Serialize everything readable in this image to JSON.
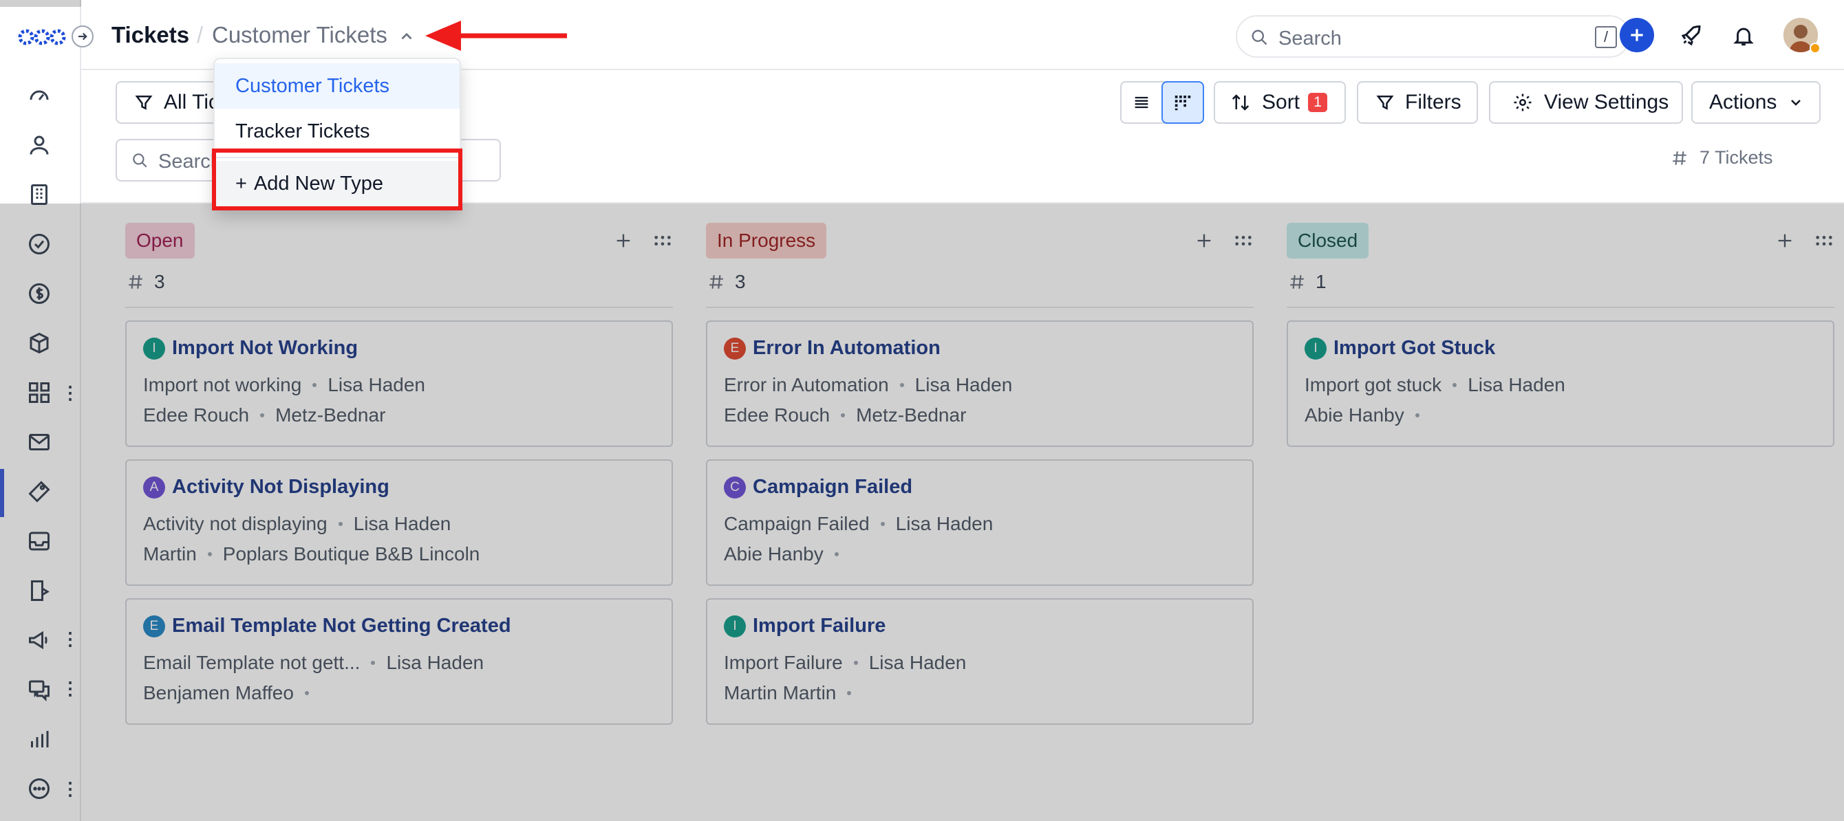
{
  "header": {
    "breadcrumb_main": "Tickets",
    "breadcrumb_sep": "/",
    "breadcrumb_sub": "Customer Tickets",
    "search_placeholder": "Search",
    "search_shortcut": "/"
  },
  "dropdown": {
    "items": [
      "Customer Tickets",
      "Tracker Tickets"
    ],
    "selected": "Customer Tickets",
    "add_label": "Add New Type",
    "add_prefix": "+"
  },
  "toolbar": {
    "all_tickets_label": "All Tickets",
    "sort_label": "Sort",
    "sort_count": "1",
    "filters_label": "Filters",
    "view_settings_label": "View Settings",
    "actions_label": "Actions",
    "search_placeholder": "Search",
    "ticket_count": "7 Tickets"
  },
  "sidebar": {
    "icons": [
      "dashboard-icon",
      "contacts-icon",
      "companies-icon",
      "tasks-icon",
      "deals-icon",
      "products-icon",
      "apps-icon",
      "mail-icon",
      "tickets-icon",
      "inbox-icon",
      "knowledge-icon",
      "campaigns-icon",
      "chat-icon",
      "reports-icon",
      "more-icon"
    ],
    "active": "tickets-icon"
  },
  "columns": [
    {
      "name": "Open",
      "count": "3",
      "pill_bg": "#f5d0dc",
      "pill_fg": "#9d174d",
      "cards": [
        {
          "badge": "I",
          "badge_color": "#0f9d8a",
          "title": "Import Not Working",
          "line1_a": "Import not working",
          "line1_b": "Lisa Haden",
          "line2_a": "Edee Rouch",
          "line2_b": "Metz-Bednar"
        },
        {
          "badge": "A",
          "badge_color": "#6d4fd6",
          "title": "Activity Not Displaying",
          "line1_a": "Activity not displaying",
          "line1_b": "Lisa Haden",
          "line2_a": "Martin",
          "line2_b": "Poplars Boutique B&B Lincoln"
        },
        {
          "badge": "E",
          "badge_color": "#2186c4",
          "title": "Email Template Not Getting Created",
          "line1_a": "Email Template not gett...",
          "line1_b": "Lisa Haden",
          "line2_a": "Benjamen Maffeo",
          "line2_b": ""
        }
      ]
    },
    {
      "name": "In Progress",
      "count": "3",
      "pill_bg": "#f9d0cc",
      "pill_fg": "#9b1c1c",
      "cards": [
        {
          "badge": "E",
          "badge_color": "#e0452b",
          "title": "Error In Automation",
          "line1_a": "Error in Automation",
          "line1_b": "Lisa Haden",
          "line2_a": "Edee Rouch",
          "line2_b": "Metz-Bednar"
        },
        {
          "badge": "C",
          "badge_color": "#6d4fd6",
          "title": "Campaign Failed",
          "line1_a": "Campaign Failed",
          "line1_b": "Lisa Haden",
          "line2_a": "Abie Hanby",
          "line2_b": ""
        },
        {
          "badge": "I",
          "badge_color": "#0f9d8a",
          "title": "Import Failure",
          "line1_a": "Import Failure",
          "line1_b": "Lisa Haden",
          "line2_a": "Martin Martin",
          "line2_b": ""
        }
      ]
    },
    {
      "name": "Closed",
      "count": "1",
      "pill_bg": "#c6ecec",
      "pill_fg": "#134e4a",
      "cards": [
        {
          "badge": "I",
          "badge_color": "#0f9d8a",
          "title": "Import Got Stuck",
          "line1_a": "Import got stuck",
          "line1_b": "Lisa Haden",
          "line2_a": "Abie Hanby",
          "line2_b": ""
        }
      ]
    }
  ],
  "colors": {
    "accent": "#2563eb",
    "highlight": "#ef1c1c",
    "primary_button": "#1d4ed8"
  }
}
